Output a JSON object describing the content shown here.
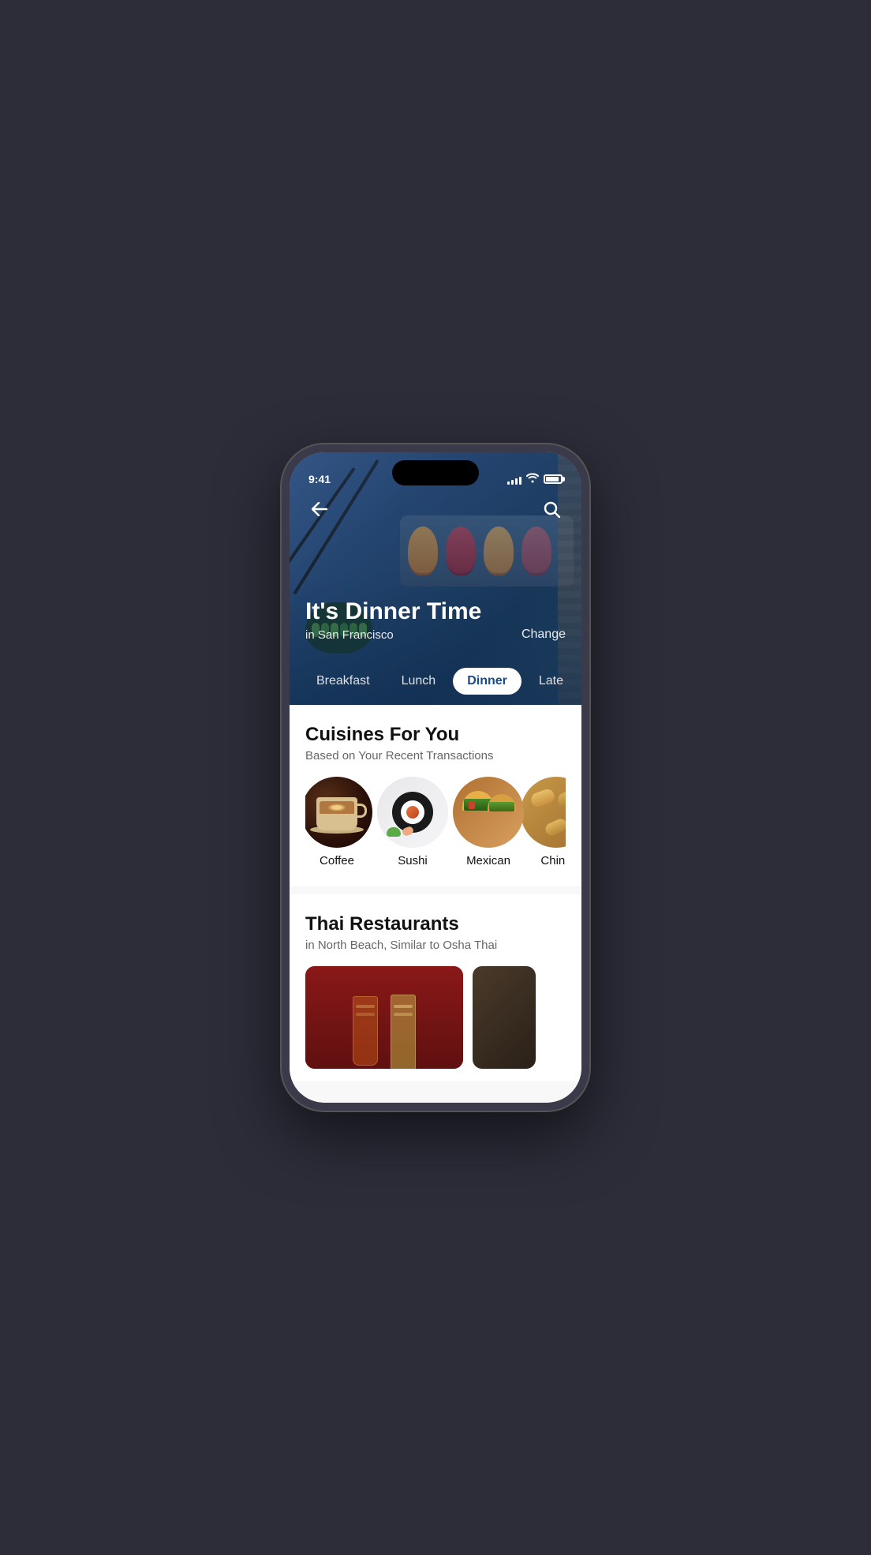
{
  "statusBar": {
    "time": "9:41",
    "signalBars": [
      4,
      6,
      8,
      10,
      12
    ],
    "wifiIcon": "wifi",
    "batteryIcon": "battery"
  },
  "nav": {
    "backLabel": "←",
    "searchLabel": "🔍"
  },
  "hero": {
    "title": "It's Dinner Time",
    "locationPrefix": "in ",
    "location": "San Francisco",
    "changeLabel": "Change"
  },
  "mealTabs": {
    "tabs": [
      {
        "label": "Breakfast",
        "active": false
      },
      {
        "label": "Lunch",
        "active": false
      },
      {
        "label": "Dinner",
        "active": true
      },
      {
        "label": "Late",
        "active": false
      }
    ]
  },
  "cuisinesSection": {
    "title": "Cuisines For You",
    "subtitle": "Based on Your Recent Transactions",
    "items": [
      {
        "label": "Coffee",
        "type": "coffee"
      },
      {
        "label": "Sushi",
        "type": "sushi"
      },
      {
        "label": "Mexican",
        "type": "mexican"
      },
      {
        "label": "Chinese",
        "type": "chinese"
      }
    ]
  },
  "thaiSection": {
    "title": "Thai Restaurants",
    "subtitle": "in North Beach, Similar to Osha Thai"
  },
  "colors": {
    "heroBg": "#2d5080",
    "activeTabBg": "#ffffff",
    "activeTabText": "#1a4a8a"
  }
}
